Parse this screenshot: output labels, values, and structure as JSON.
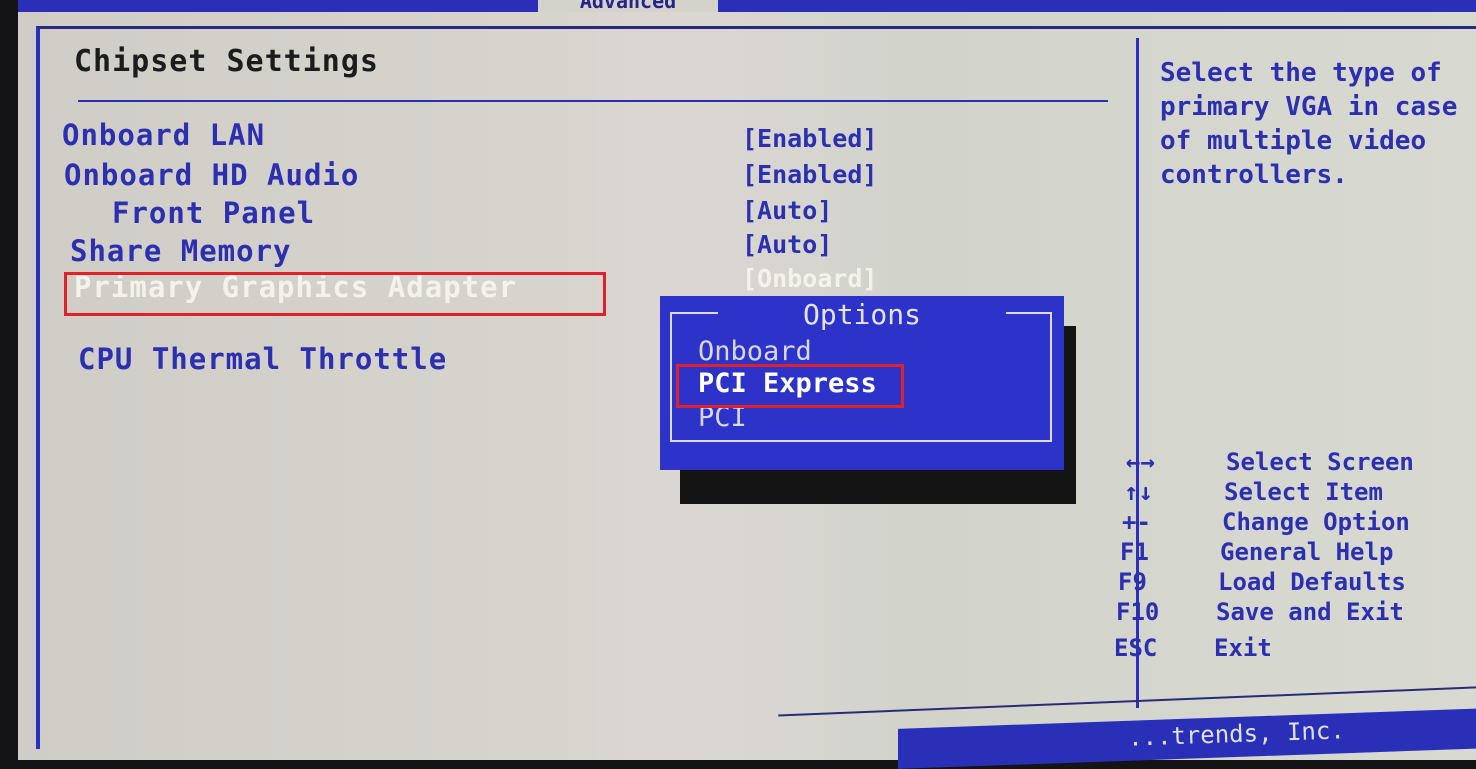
{
  "top_tab": {
    "label": "Advanced"
  },
  "page_title": "Chipset Settings",
  "settings": [
    {
      "label": "Onboard LAN",
      "value": "[Enabled]",
      "indent": false,
      "selected": false
    },
    {
      "label": "Onboard HD Audio",
      "value": "[Enabled]",
      "indent": false,
      "selected": false
    },
    {
      "label": "Front Panel",
      "value": "[Auto]",
      "indent": true,
      "selected": false
    },
    {
      "label": "Share Memory",
      "value": "[Auto]",
      "indent": false,
      "selected": false
    },
    {
      "label": "Primary Graphics Adapter",
      "value": "[Onboard]",
      "indent": false,
      "selected": true
    },
    {
      "label": "CPU Thermal Throttle",
      "value": "",
      "indent": false,
      "selected": false
    }
  ],
  "popup": {
    "title": "Options",
    "options": [
      {
        "label": "Onboard",
        "highlighted": false
      },
      {
        "label": "PCI Express",
        "highlighted": true
      },
      {
        "label": "PCI",
        "highlighted": false
      }
    ]
  },
  "help": {
    "lines": [
      "Select the type of",
      "primary VGA in case",
      "of multiple video",
      "controllers."
    ]
  },
  "key_legend": [
    {
      "key": "←→",
      "action": "Select Screen"
    },
    {
      "key": "↑↓",
      "action": "Select Item"
    },
    {
      "key": "+-",
      "action": "Change Option"
    },
    {
      "key": "F1",
      "action": "General Help"
    },
    {
      "key": "F9",
      "action": "Load Defaults"
    },
    {
      "key": "F10",
      "action": "Save and Exit"
    },
    {
      "key": "ESC",
      "action": "Exit"
    }
  ],
  "footer": {
    "text": "...trends, Inc."
  },
  "colors": {
    "bios_blue": "#2b2fb0",
    "background": "#d3d2cb",
    "highlight_box": "#e0212a",
    "popup_bg": "#2d33c8"
  }
}
